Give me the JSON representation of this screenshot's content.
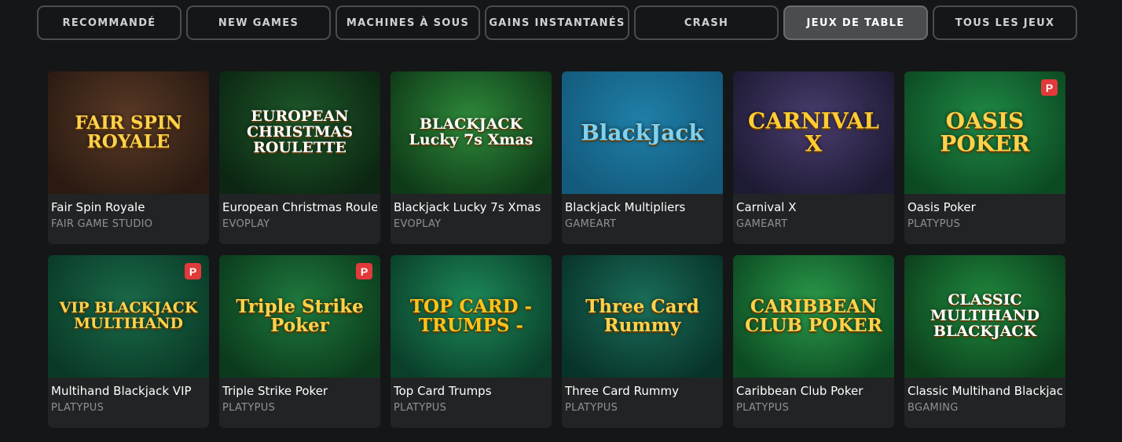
{
  "tabs": [
    {
      "label": "RECOMMANDÉ",
      "active": false
    },
    {
      "label": "NEW GAMES",
      "active": false
    },
    {
      "label": "MACHINES À SOUS",
      "active": false
    },
    {
      "label": "GAINS INSTANTANÉS",
      "active": false
    },
    {
      "label": "CRASH",
      "active": false
    },
    {
      "label": "JEUX DE TABLE",
      "active": true
    },
    {
      "label": "TOUS LES JEUX",
      "active": false
    }
  ],
  "games": [
    {
      "title": "Fair Spin Royale",
      "provider": "FAIR GAME STUDIO",
      "logo": "FAIR SPIN ROYALE",
      "bg": "#5a3a26",
      "bg2": "#2a1a12",
      "logoColor": "#ffd24a",
      "badge": ""
    },
    {
      "title": "European Christmas Roulette",
      "provider": "EVOPLAY",
      "logo": "EUROPEAN CHRISTMAS ROULETTE",
      "bg": "#1d5a2a",
      "bg2": "#0c2612",
      "logoColor": "#ffffff",
      "badge": ""
    },
    {
      "title": "Blackjack Lucky 7s Xmas",
      "provider": "EVOPLAY",
      "logo": "BLACKJACK Lucky 7s Xmas",
      "bg": "#2e8a3a",
      "bg2": "#0f3a18",
      "logoColor": "#ffffff",
      "badge": ""
    },
    {
      "title": "Blackjack Multipliers",
      "provider": "GAMEART",
      "logo": "BlackJack",
      "bg": "#1f7fa8",
      "bg2": "#135a7c",
      "logoColor": "#7fd2f0",
      "badge": ""
    },
    {
      "title": "Carnival X",
      "provider": "GAMEART",
      "logo": "CARNIVAL X",
      "bg": "#4a3d6e",
      "bg2": "#1d1a33",
      "logoColor": "#ffcc33",
      "badge": ""
    },
    {
      "title": "Oasis Poker",
      "provider": "PLATYPUS",
      "logo": "OASIS POKER",
      "bg": "#1f8a46",
      "bg2": "#0c4a22",
      "logoColor": "#ffd24a",
      "badge": "P"
    },
    {
      "title": "Multihand Blackjack VIP",
      "provider": "PLATYPUS",
      "logo": "VIP BLACKJACK MULTIHAND",
      "bg": "#1a6a4a",
      "bg2": "#0a3a26",
      "logoColor": "#ffd24a",
      "badge": "P"
    },
    {
      "title": "Triple Strike Poker",
      "provider": "PLATYPUS",
      "logo": "Triple Strike Poker",
      "bg": "#1f7a3e",
      "bg2": "#0b3a1c",
      "logoColor": "#ffd24a",
      "badge": "P"
    },
    {
      "title": "Top Card Trumps",
      "provider": "PLATYPUS",
      "logo": "TOP CARD - TRUMPS -",
      "bg": "#1d8a5a",
      "bg2": "#0a3f2a",
      "logoColor": "#ffc21a",
      "badge": ""
    },
    {
      "title": "Three Card Rummy",
      "provider": "PLATYPUS",
      "logo": "Three Card Rummy",
      "bg": "#1a6e5a",
      "bg2": "#08332a",
      "logoColor": "#ffd24a",
      "badge": ""
    },
    {
      "title": "Caribbean Club Poker",
      "provider": "PLATYPUS",
      "logo": "CARIBBEAN CLUB POKER",
      "bg": "#2a9a4a",
      "bg2": "#0c4a22",
      "logoColor": "#ffd24a",
      "badge": ""
    },
    {
      "title": "Classic Multihand Blackjack",
      "provider": "BGAMING",
      "logo": "CLASSIC MULTIHAND BLACKJACK",
      "bg": "#1f8a3e",
      "bg2": "#0c3f1c",
      "logoColor": "#ffffff",
      "badge": ""
    }
  ]
}
